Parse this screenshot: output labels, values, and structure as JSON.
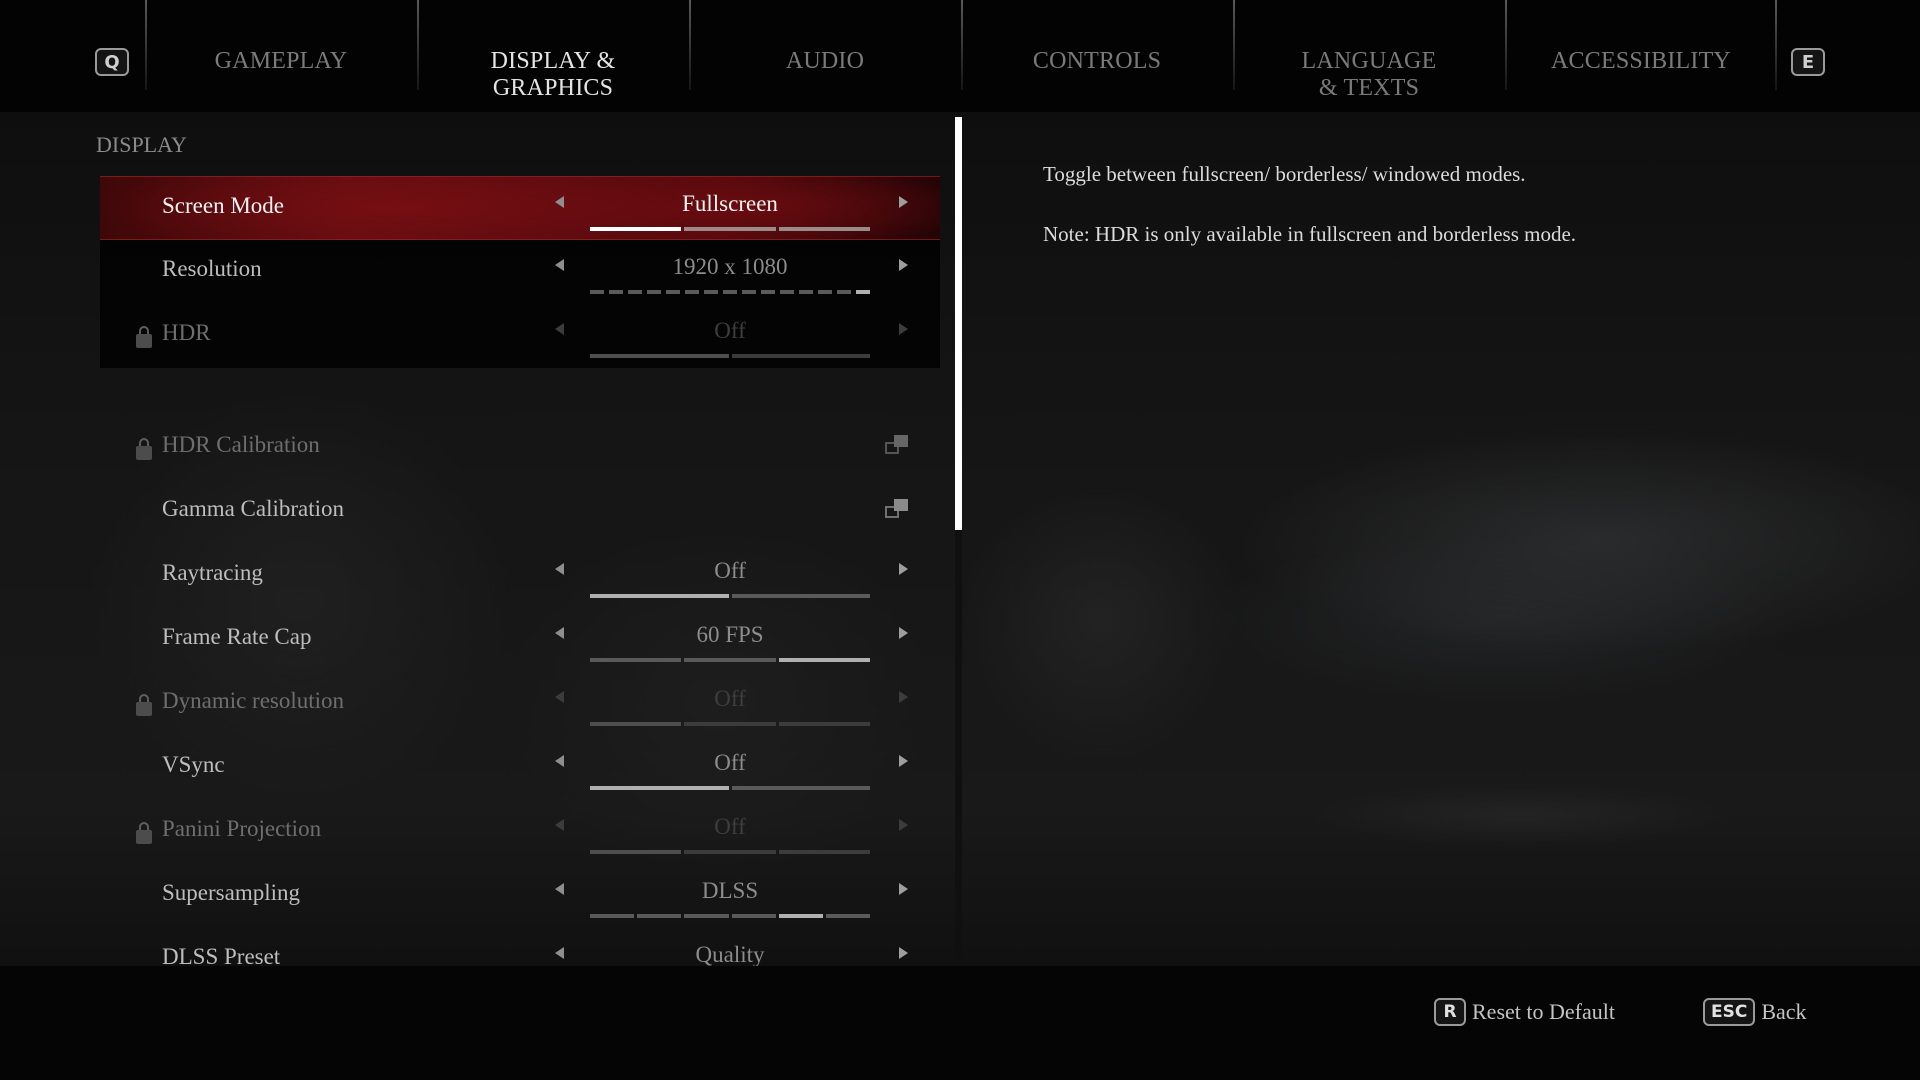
{
  "header": {
    "prev_key": "Q",
    "next_key": "E",
    "tabs": [
      {
        "label": "GAMEPLAY",
        "active": false
      },
      {
        "label": "DISPLAY & GRAPHICS",
        "active": true
      },
      {
        "label": "AUDIO",
        "active": false
      },
      {
        "label": "CONTROLS",
        "active": false
      },
      {
        "label": "LANGUAGE & TEXTS",
        "active": false
      },
      {
        "label": "ACCESSIBILITY",
        "active": false
      }
    ]
  },
  "section": {
    "title": "DISPLAY"
  },
  "settings": [
    {
      "label": "Screen Mode",
      "value": "Fullscreen",
      "type": "selector",
      "selected": true,
      "locked": false,
      "options_count": 3,
      "selected_index": 0
    },
    {
      "label": "Resolution",
      "value": "1920 x 1080",
      "type": "selector",
      "selected": false,
      "locked": false,
      "options_count": 15,
      "selected_index": 14
    },
    {
      "label": "HDR",
      "value": "Off",
      "type": "selector",
      "selected": false,
      "locked": true,
      "options_count": 2,
      "selected_index": 0
    },
    {
      "label": "HDR Calibration",
      "type": "link",
      "selected": false,
      "locked": true,
      "icon": "external-window-icon"
    },
    {
      "label": "Gamma Calibration",
      "type": "link",
      "selected": false,
      "locked": false,
      "icon": "external-window-icon"
    },
    {
      "label": "Raytracing",
      "value": "Off",
      "type": "selector",
      "selected": false,
      "locked": false,
      "options_count": 2,
      "selected_index": 0
    },
    {
      "label": "Frame Rate Cap",
      "value": "60 FPS",
      "type": "selector",
      "selected": false,
      "locked": false,
      "options_count": 3,
      "selected_index": 2
    },
    {
      "label": "Dynamic resolution",
      "value": "Off",
      "type": "selector",
      "selected": false,
      "locked": true,
      "options_count": 3,
      "selected_index": 0
    },
    {
      "label": "VSync",
      "value": "Off",
      "type": "selector",
      "selected": false,
      "locked": false,
      "options_count": 2,
      "selected_index": 0
    },
    {
      "label": "Panini Projection",
      "value": "Off",
      "type": "selector",
      "selected": false,
      "locked": true,
      "options_count": 3,
      "selected_index": 0
    },
    {
      "label": "Supersampling",
      "value": "DLSS",
      "type": "selector",
      "selected": false,
      "locked": false,
      "options_count": 6,
      "selected_index": 4
    },
    {
      "label": "DLSS Preset",
      "value": "Quality",
      "type": "selector",
      "selected": false,
      "locked": false
    }
  ],
  "scrollbar": {
    "visible_fraction": 0.49,
    "position": 0.0
  },
  "description": {
    "line1": "Toggle between fullscreen/ borderless/ windowed modes.",
    "line2": "Note: HDR is only available in fullscreen and borderless mode."
  },
  "footer": {
    "reset": {
      "key": "R",
      "label": "Reset to Default"
    },
    "back": {
      "key": "ESC",
      "label": "Back"
    }
  },
  "colors": {
    "selected_row": "#6a0c10",
    "text_primary": "#e4e4e4",
    "text_muted": "#7a7a7a"
  }
}
